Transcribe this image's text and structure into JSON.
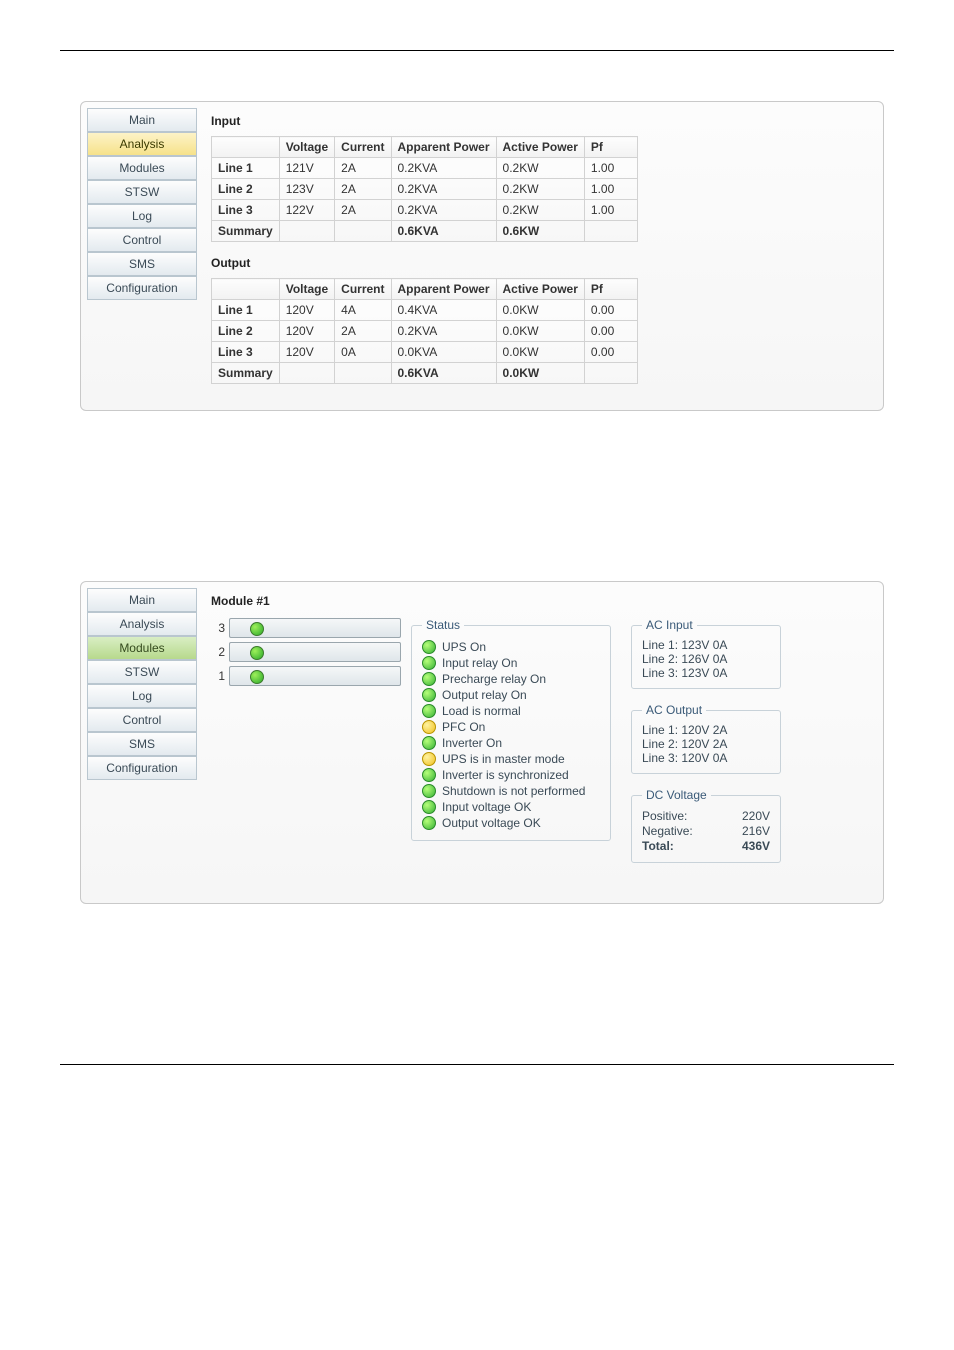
{
  "nav_items": [
    "Main",
    "Analysis",
    "Modules",
    "STSW",
    "Log",
    "Control",
    "SMS",
    "Configuration"
  ],
  "panel_analysis": {
    "selected_nav_index": 1,
    "selection_style": "yellow",
    "tables": {
      "input": {
        "title": "Input",
        "headers": [
          "",
          "Voltage",
          "Current",
          "Apparent Power",
          "Active Power",
          "Pf"
        ],
        "rows": [
          [
            "Line 1",
            "121V",
            "2A",
            "0.2KVA",
            "0.2KW",
            "1.00"
          ],
          [
            "Line 2",
            "123V",
            "2A",
            "0.2KVA",
            "0.2KW",
            "1.00"
          ],
          [
            "Line 3",
            "122V",
            "2A",
            "0.2KVA",
            "0.2KW",
            "1.00"
          ]
        ],
        "summary": [
          "Summary",
          "",
          "",
          "0.6KVA",
          "0.6KW",
          ""
        ]
      },
      "output": {
        "title": "Output",
        "headers": [
          "",
          "Voltage",
          "Current",
          "Apparent Power",
          "Active Power",
          "Pf"
        ],
        "rows": [
          [
            "Line 1",
            "120V",
            "4A",
            "0.4KVA",
            "0.0KW",
            "0.00"
          ],
          [
            "Line 2",
            "120V",
            "2A",
            "0.2KVA",
            "0.0KW",
            "0.00"
          ],
          [
            "Line 3",
            "120V",
            "0A",
            "0.0KVA",
            "0.0KW",
            "0.00"
          ]
        ],
        "summary": [
          "Summary",
          "",
          "",
          "0.6KVA",
          "0.0KW",
          ""
        ]
      }
    }
  },
  "panel_modules": {
    "selected_nav_index": 2,
    "selection_style": "green",
    "title": "Module #1",
    "slots": [
      {
        "num": "3",
        "present": true
      },
      {
        "num": "2",
        "present": true
      },
      {
        "num": "1",
        "present": true
      }
    ],
    "status_title": "Status",
    "status": [
      {
        "dot": "green",
        "text": "UPS On"
      },
      {
        "dot": "green",
        "text": "Input relay On"
      },
      {
        "dot": "green",
        "text": "Precharge relay On"
      },
      {
        "dot": "green",
        "text": "Output relay On"
      },
      {
        "dot": "green",
        "text": "Load is normal"
      },
      {
        "dot": "yellow",
        "text": "PFC On"
      },
      {
        "dot": "green",
        "text": "Inverter On"
      },
      {
        "dot": "yellow",
        "text": "UPS is in master mode"
      },
      {
        "dot": "green",
        "text": "Inverter is synchronized"
      },
      {
        "dot": "green",
        "text": "Shutdown is not performed"
      },
      {
        "dot": "green",
        "text": "Input voltage OK"
      },
      {
        "dot": "green",
        "text": "Output voltage OK"
      }
    ],
    "ac_input": {
      "title": "AC Input",
      "lines": [
        "Line 1: 123V 0A",
        "Line 2: 126V 0A",
        "Line 3: 123V 0A"
      ]
    },
    "ac_output": {
      "title": "AC Output",
      "lines": [
        "Line 1: 120V 2A",
        "Line 2: 120V 2A",
        "Line 3: 120V 0A"
      ]
    },
    "dc_voltage": {
      "title": "DC Voltage",
      "rows": [
        {
          "k": "Positive:",
          "v": "220V"
        },
        {
          "k": "Negative:",
          "v": "216V"
        },
        {
          "k": "Total:",
          "v": "436V",
          "bold": true
        }
      ]
    }
  }
}
